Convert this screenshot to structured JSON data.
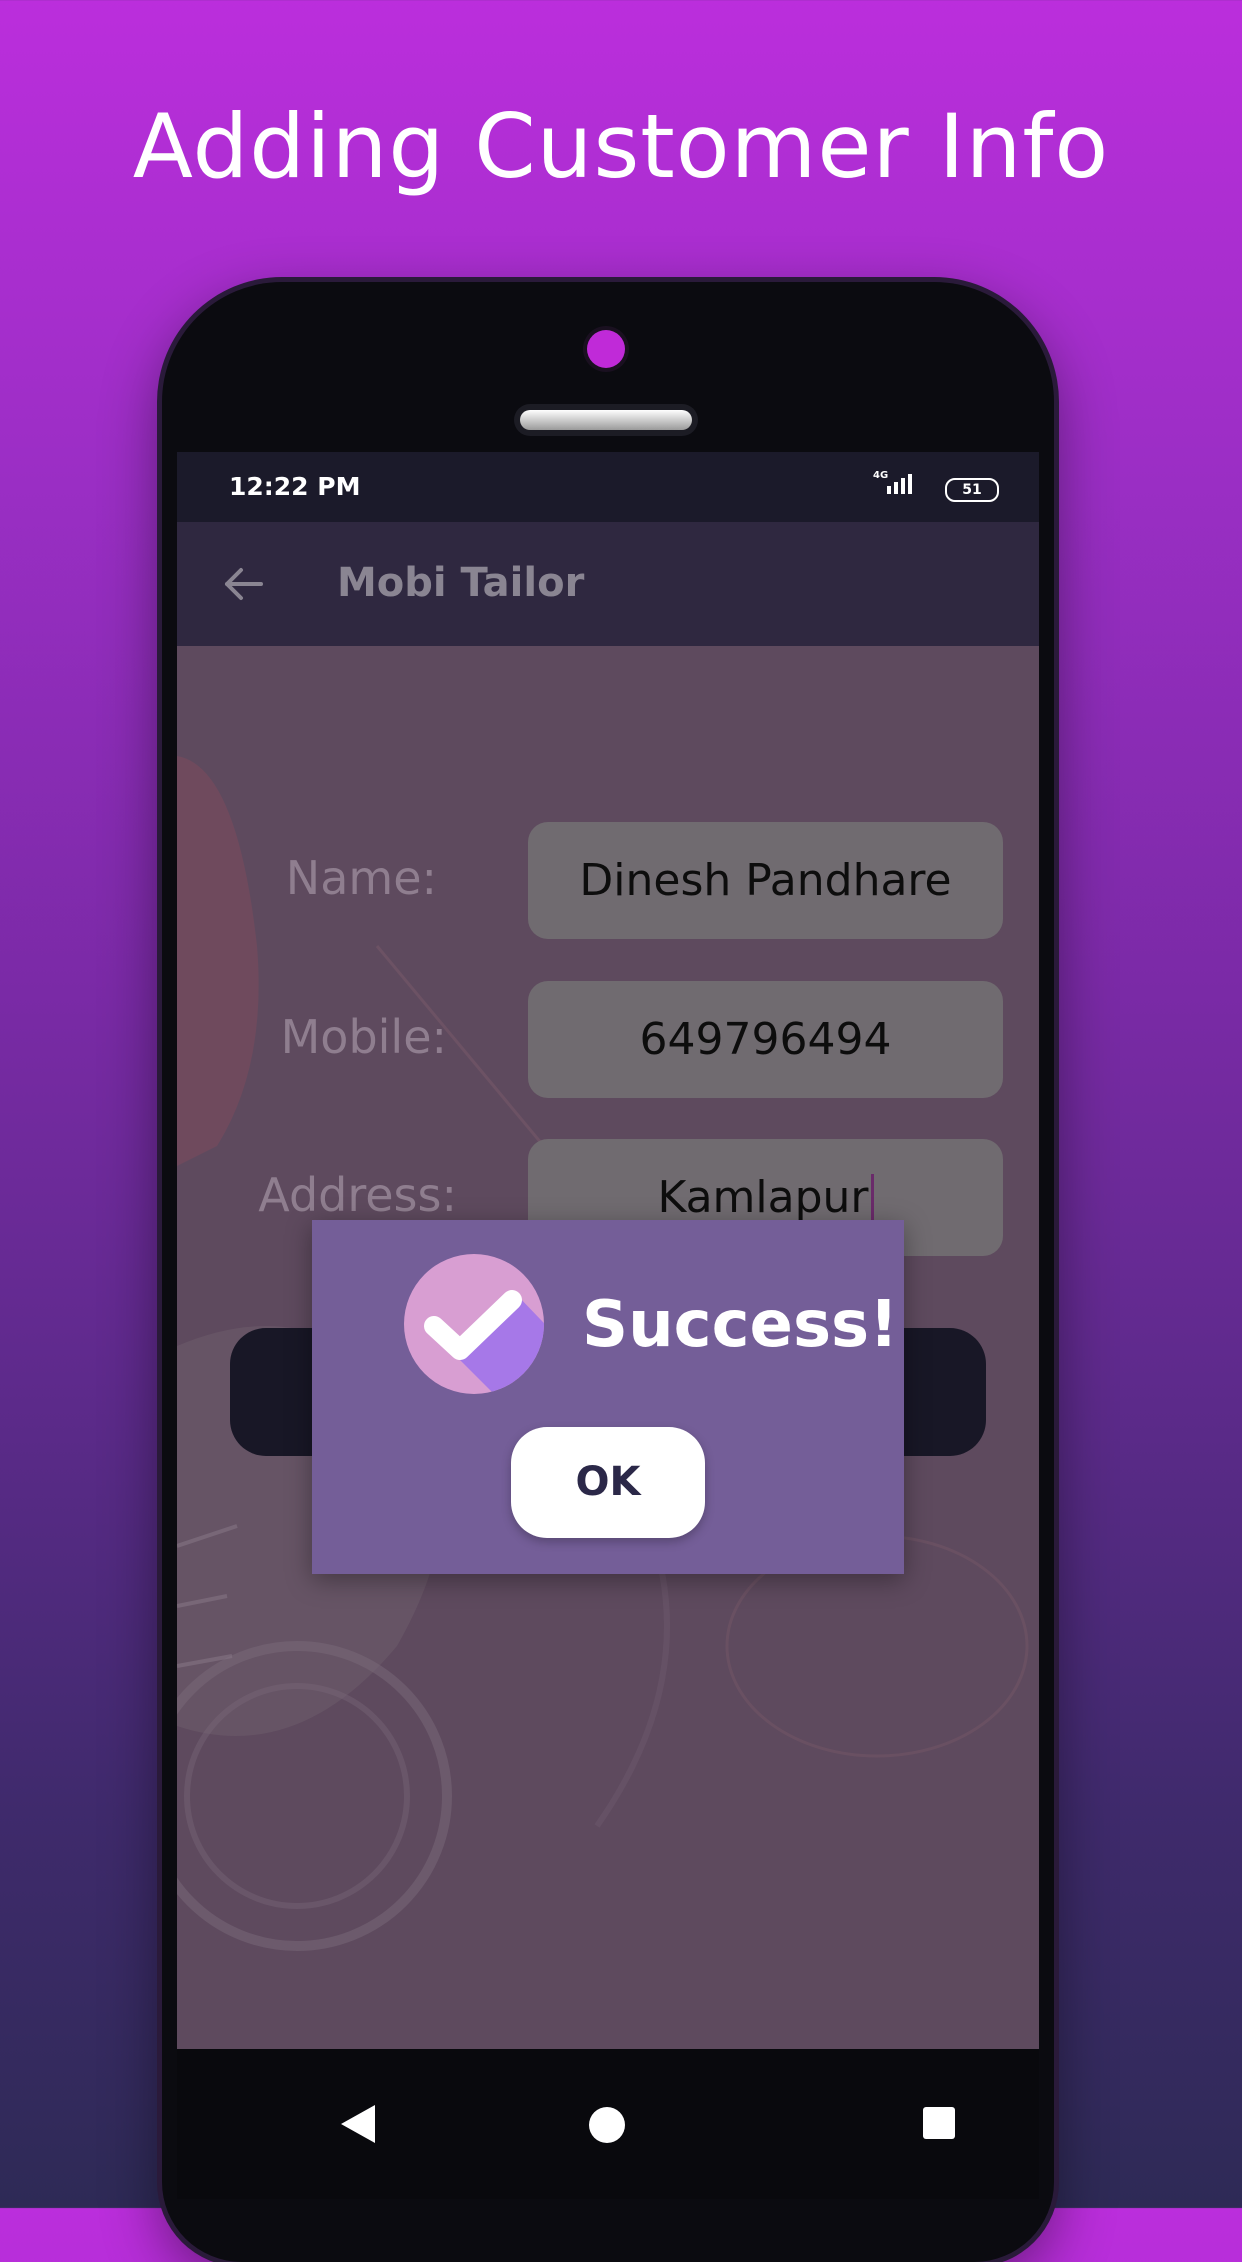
{
  "headline": "Adding Customer Info",
  "status_bar": {
    "time": "12:22 PM",
    "network": "4G",
    "battery": "51"
  },
  "app_bar": {
    "title": "Mobi Tailor"
  },
  "form": {
    "name_label": "Name:",
    "name_value": "Dinesh Pandhare",
    "mobile_label": "Mobile:",
    "mobile_value": "649796494",
    "address_label": "Address:",
    "address_value": "Kamlapur"
  },
  "dialog": {
    "message": "Success!",
    "ok_label": "OK",
    "icon": "check-circle-icon"
  },
  "colors": {
    "background_top": "#bb2edc",
    "background_bottom": "#2e2a56",
    "app_bar": "#2f2840",
    "dialog": "#745e98",
    "check_circle_light": "#d89ed2",
    "check_circle_dark": "#a678e8"
  }
}
